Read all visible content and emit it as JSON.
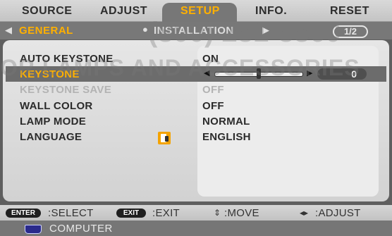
{
  "menu": {
    "tabs": [
      {
        "label": "SOURCE"
      },
      {
        "label": "ADJUST"
      },
      {
        "label": "SETUP",
        "active": true
      },
      {
        "label": "INFO."
      },
      {
        "label": "RESET"
      }
    ]
  },
  "subtabs": {
    "items": [
      {
        "label": "GENERAL",
        "active": true
      },
      {
        "label": "INSTALLATION"
      }
    ],
    "page_indicator": "1/2"
  },
  "settings": [
    {
      "label": "AUTO KEYSTONE",
      "value": "ON"
    },
    {
      "label": "KEYSTONE",
      "value": "",
      "selected": true
    },
    {
      "label": "KEYSTONE SAVE",
      "value": "OFF",
      "disabled": true
    },
    {
      "label": "WALL COLOR",
      "value": "OFF"
    },
    {
      "label": "LAMP MODE",
      "value": "NORMAL"
    },
    {
      "label": "LANGUAGE",
      "value": "ENGLISH"
    }
  ],
  "keystone_slider": {
    "value": "0",
    "level": 0.5
  },
  "footer": {
    "enter_key": "ENTER",
    "enter_action": ":SELECT",
    "exit_key": "EXIT",
    "exit_action": ":EXIT",
    "move_action": ":MOVE",
    "adjust_action": ":ADJUST"
  },
  "source": {
    "label": "COMPUTER"
  },
  "watermark": {
    "line1": "(800) 281-8860",
    "line2": "OR LAMPS AND ACCESSORIES"
  },
  "colors": {
    "accent": "#ffb000",
    "disabled": "#b3b3b3",
    "panel": "#e6e6e6"
  },
  "icons": {
    "language": "language-icon",
    "computer_source": "vga-connector-icon"
  }
}
